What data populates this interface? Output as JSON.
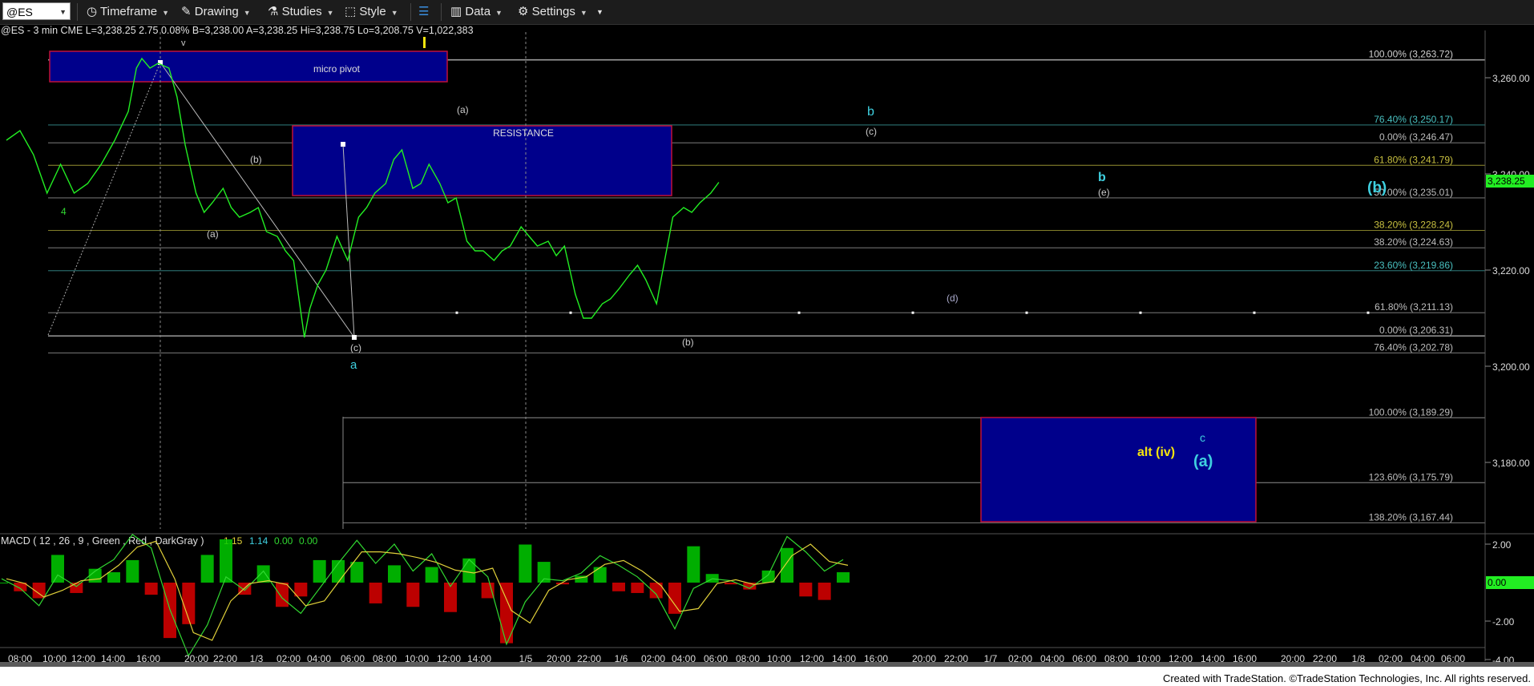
{
  "toolbar": {
    "symbol": "@ES",
    "items": [
      {
        "label": "Timeframe",
        "icon": "clock-icon"
      },
      {
        "label": "Drawing",
        "icon": "pencil-icon"
      },
      {
        "label": "Studies",
        "icon": "flask-icon"
      },
      {
        "label": "Style",
        "icon": "style-icon"
      },
      {
        "label": "Data",
        "icon": "bar-chart-icon"
      },
      {
        "label": "Settings",
        "icon": "gear-icon"
      }
    ]
  },
  "header_line": "@ES - 3 min  CME  L=3,238.25  2.75  0.08%  B=3,238.00  A=3,238.25  Hi=3,238.75  Lo=3,208.75  V=1,022,383",
  "footer": "Created with TradeStation. ©TradeStation Technologies, Inc. All rights reserved.",
  "colors": {
    "price": "#22ee22",
    "box_fill": "#00008b",
    "box_border": "#c0103a",
    "cyan": "#3fd0e0",
    "yellow": "#f4e40e",
    "macd_line": "#31d931",
    "signal_line": "#e0d03a",
    "hist_pos": "#00cc00",
    "hist_neg": "#dd0000"
  },
  "chart_data": {
    "type": "line",
    "title": "@ES - 3 min",
    "ylim": [
      3160,
      3268
    ],
    "y_ticks": [
      3180,
      3200,
      3220,
      3240,
      3260
    ],
    "y_tick_labels": [
      "3,180.00",
      "3,200.00",
      "3,220.00",
      "3,240.00",
      "3,260.00"
    ],
    "x_tick_labels": [
      "08:00",
      "10:00",
      "12:00",
      "14:00",
      "16:00",
      "20:00",
      "22:00",
      "1/3",
      "02:00",
      "04:00",
      "06:00",
      "08:00",
      "10:00",
      "12:00",
      "14:00",
      "1/5",
      "20:00",
      "22:00",
      "1/6",
      "02:00",
      "04:00",
      "06:00",
      "08:00",
      "10:00",
      "12:00",
      "14:00",
      "16:00",
      "20:00",
      "22:00",
      "1/7",
      "02:00",
      "04:00",
      "06:00",
      "08:00",
      "10:00",
      "12:00",
      "14:00",
      "16:00",
      "20:00",
      "22:00",
      "1/8",
      "02:00",
      "04:00",
      "06:00"
    ],
    "last_price_label": "3,238.25",
    "series": [
      {
        "name": "@ES",
        "points": [
          [
            0,
            3247
          ],
          [
            0.5,
            3249
          ],
          [
            1,
            3244
          ],
          [
            1.5,
            3236
          ],
          [
            2,
            3242
          ],
          [
            2.5,
            3236
          ],
          [
            3,
            3238
          ],
          [
            3.5,
            3242
          ],
          [
            4,
            3247
          ],
          [
            4.5,
            3253
          ],
          [
            4.8,
            3262
          ],
          [
            5,
            3264
          ],
          [
            5.3,
            3262
          ],
          [
            5.6,
            3263
          ],
          [
            6,
            3262
          ],
          [
            6.3,
            3256
          ],
          [
            6.6,
            3246
          ],
          [
            7,
            3236
          ],
          [
            7.3,
            3232
          ],
          [
            7.6,
            3234
          ],
          [
            8,
            3237
          ],
          [
            8.3,
            3233
          ],
          [
            8.6,
            3231
          ],
          [
            9,
            3232
          ],
          [
            9.3,
            3233
          ],
          [
            9.6,
            3228
          ],
          [
            10,
            3227
          ],
          [
            10.3,
            3224
          ],
          [
            10.6,
            3222
          ],
          [
            11,
            3206
          ],
          [
            11.2,
            3212
          ],
          [
            11.5,
            3217
          ],
          [
            11.8,
            3220
          ],
          [
            12.2,
            3227
          ],
          [
            12.6,
            3222
          ],
          [
            13,
            3231
          ],
          [
            13.3,
            3233
          ],
          [
            13.6,
            3236
          ],
          [
            14,
            3238
          ],
          [
            14.3,
            3243
          ],
          [
            14.6,
            3245
          ],
          [
            15,
            3237
          ],
          [
            15.3,
            3238
          ],
          [
            15.6,
            3242
          ],
          [
            16,
            3238
          ],
          [
            16.3,
            3234
          ],
          [
            16.6,
            3235
          ],
          [
            17,
            3226
          ],
          [
            17.3,
            3224
          ],
          [
            17.6,
            3224
          ],
          [
            18,
            3222
          ],
          [
            18.3,
            3224
          ],
          [
            18.6,
            3225
          ],
          [
            19,
            3229
          ],
          [
            19.3,
            3227
          ],
          [
            19.6,
            3225
          ],
          [
            20,
            3226
          ],
          [
            20.3,
            3223
          ],
          [
            20.6,
            3225
          ],
          [
            21,
            3215
          ],
          [
            21.3,
            3210
          ],
          [
            21.6,
            3210
          ],
          [
            22,
            3213
          ],
          [
            22.3,
            3214
          ],
          [
            22.6,
            3216
          ],
          [
            23,
            3219
          ],
          [
            23.3,
            3221
          ],
          [
            23.6,
            3218
          ],
          [
            24,
            3213
          ],
          [
            24.3,
            3222
          ],
          [
            24.6,
            3231
          ],
          [
            25,
            3233
          ],
          [
            25.3,
            3232
          ],
          [
            25.6,
            3234
          ],
          [
            26,
            3236
          ],
          [
            26.3,
            3238.25
          ]
        ]
      },
      {
        "name": "MACD",
        "values": [
          0.2,
          -0.3,
          -1.2,
          0.4,
          -0.2,
          0.6,
          1.2,
          2.5,
          1.8,
          -1.4,
          -3.8,
          -2.2,
          0.3,
          -0.4,
          0.6,
          -0.8,
          -1.6,
          -0.3,
          1.0,
          2.2,
          1.0,
          2.0,
          0.6,
          1.5,
          -0.2,
          1.2,
          0.3,
          -3.2,
          -1.0,
          0.2,
          0.1,
          0.5,
          1.4,
          0.9,
          0.3,
          -0.6,
          -2.4,
          -0.3,
          0.2,
          0.1,
          -0.3,
          0.4,
          2.4,
          1.6,
          0.6,
          1.2
        ]
      }
    ],
    "macd": {
      "label": "MACD ( 12 , 26 , 9 , Green , Red , DarkGray )",
      "v1": "1.15",
      "v2": "1.14",
      "v3": "0.00",
      "v4": "0.00",
      "ylim": [
        -5,
        3.2
      ],
      "y_tick_labels": [
        "2.00",
        "-2.00",
        "-4.00"
      ],
      "zero_label": "0.00"
    },
    "fib_levels_upper": [
      {
        "label": "100.00% (3,263.72)",
        "value": 3263.72,
        "color": "#cfcfcf"
      },
      {
        "label": "76.40% (3,250.17)",
        "value": 3250.17,
        "color": "#49c0c0"
      },
      {
        "label": "0.00% (3,246.47)",
        "value": 3246.47,
        "color": "#bdbdbd"
      },
      {
        "label": "61.80% (3,241.79)",
        "value": 3241.79,
        "color": "#c8c040"
      },
      {
        "label": "50.00% (3,235.01)",
        "value": 3235.01,
        "color": "#bdbdbd"
      },
      {
        "label": "38.20% (3,228.24)",
        "value": 3228.24,
        "color": "#c8c040"
      },
      {
        "label": "38.20% (3,224.63)",
        "value": 3224.63,
        "color": "#bdbdbd"
      },
      {
        "label": "23.60% (3,219.86)",
        "value": 3219.86,
        "color": "#49c0c0"
      },
      {
        "label": "61.80% (3,211.13)",
        "value": 3211.13,
        "color": "#bdbdbd"
      },
      {
        "label": "0.00% (3,206.31)",
        "value": 3206.31,
        "color": "#bdbdbd"
      },
      {
        "label": "76.40% (3,202.78)",
        "value": 3202.78,
        "color": "#bdbdbd"
      },
      {
        "label": "100.00% (3,189.29)",
        "value": 3189.29,
        "color": "#bdbdbd"
      },
      {
        "label": "123.60% (3,175.79)",
        "value": 3175.79,
        "color": "#bdbdbd"
      },
      {
        "label": "138.20% (3,167.44)",
        "value": 3167.44,
        "color": "#bdbdbd"
      }
    ],
    "annotations": {
      "box_micro_pivot": "micro pivot",
      "box_resistance": "RESISTANCE",
      "wave_4": "4",
      "wave_v": "v",
      "wave_a_small1": "(a)",
      "wave_b_small1": "(b)",
      "wave_a_small2": "(a)",
      "wave_c_small": "(c)",
      "wave_a": "a",
      "wave_b_small2": "(b)",
      "wave_b_top": "b",
      "wave_c_top": "(c)",
      "wave_b_right": "b",
      "wave_e": "(e)",
      "wave_d": "(d)",
      "wave_B_big": "(b)",
      "alt_iv": "alt (iv)",
      "wave_c_cyan": "c",
      "wave_A_big": "(a)"
    }
  }
}
